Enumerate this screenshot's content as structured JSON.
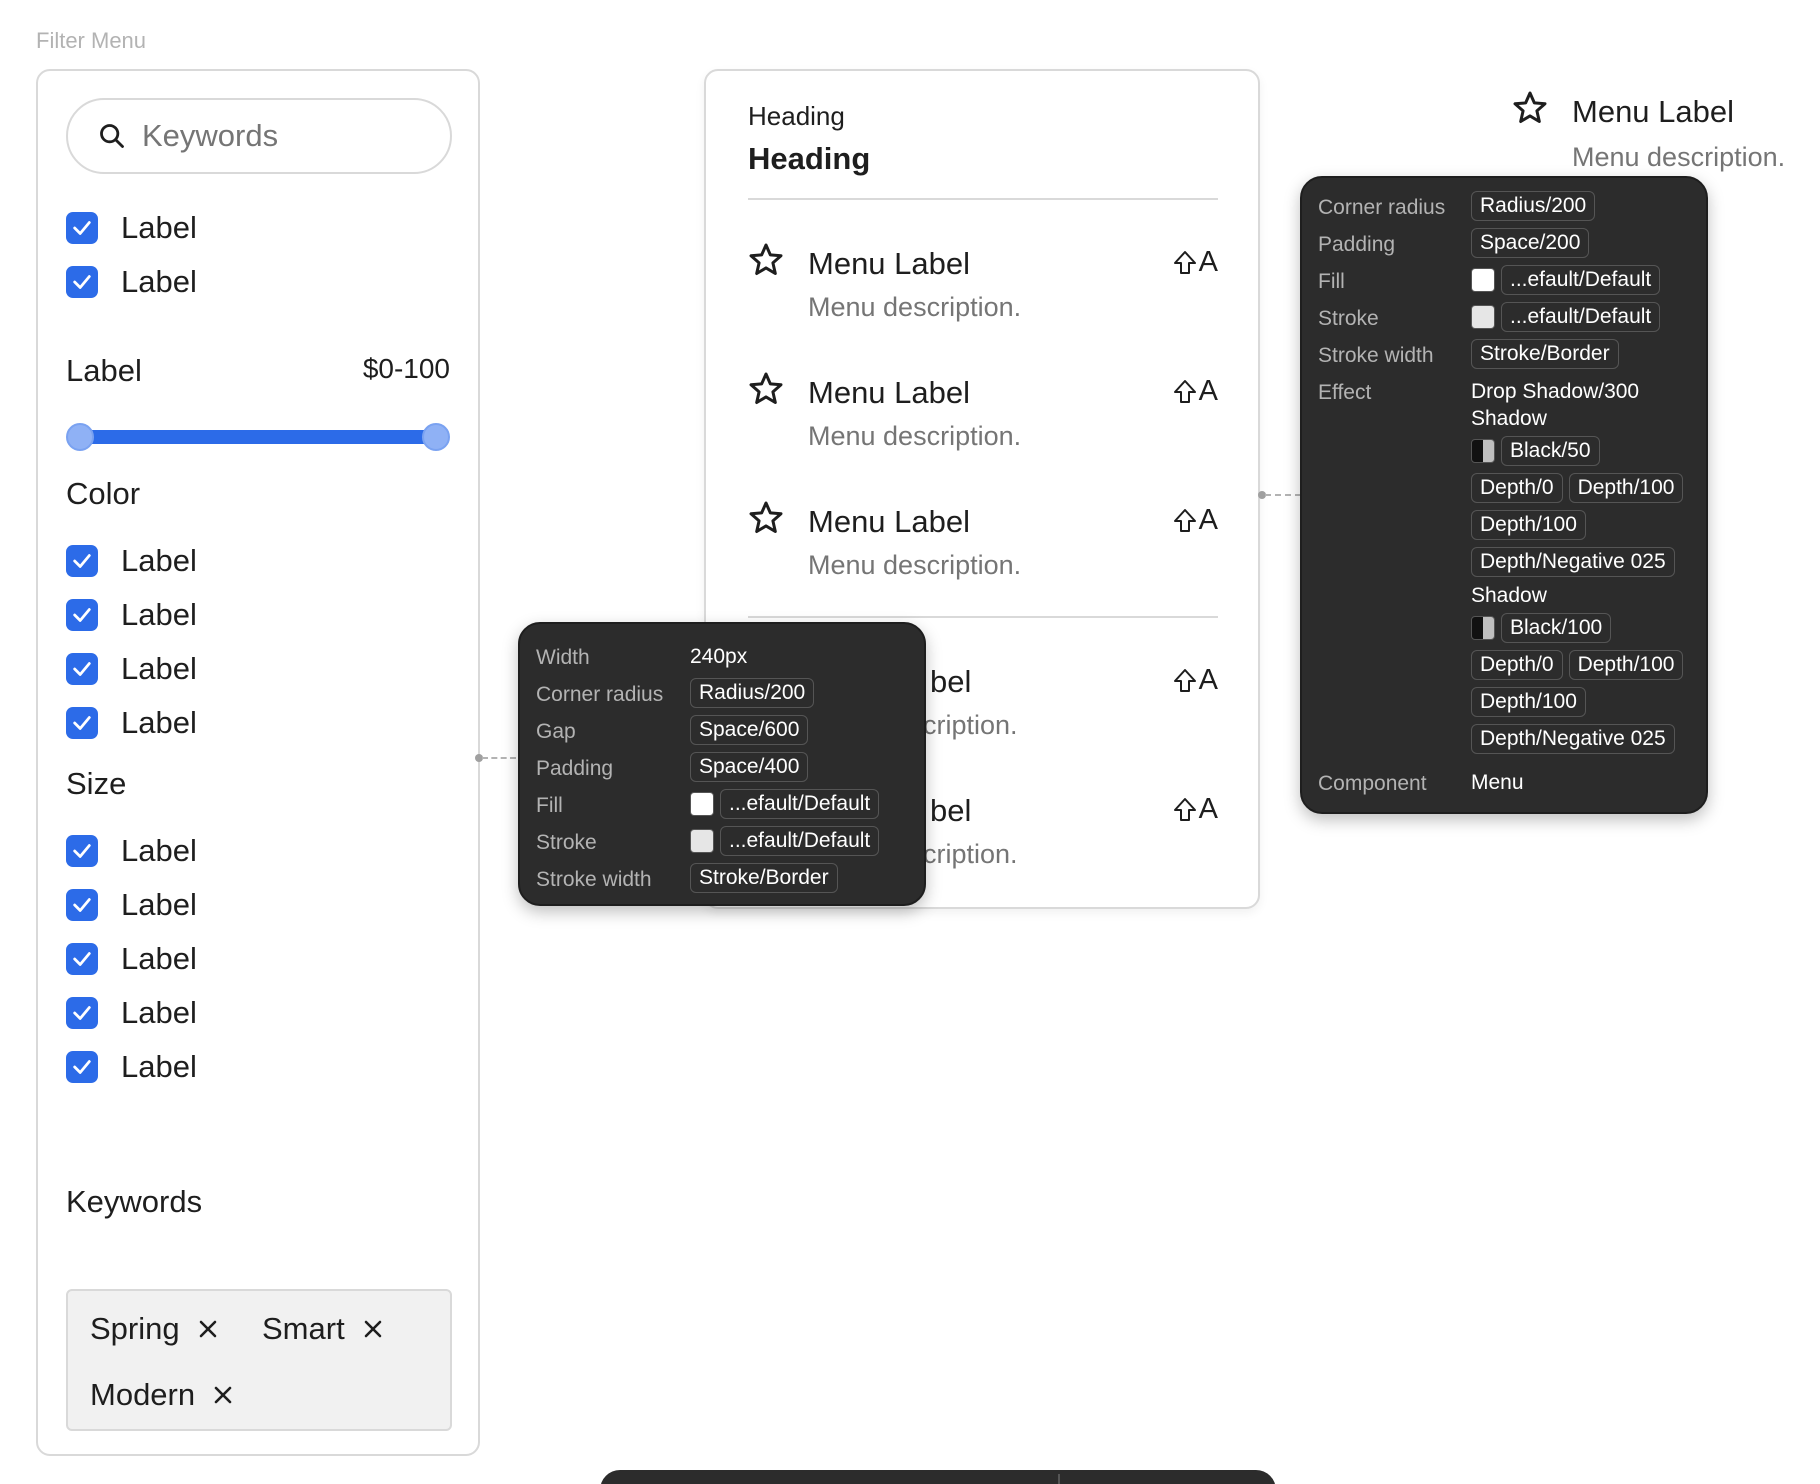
{
  "frame_title": "Filter Menu",
  "filter": {
    "search_placeholder": "Keywords",
    "top_checkboxes": [
      "Label",
      "Label"
    ],
    "price": {
      "label": "Label",
      "value": "$0-100",
      "range_min_fraction": 0.0,
      "range_max_fraction": 1.0
    },
    "color": {
      "title": "Color",
      "items": [
        "Label",
        "Label",
        "Label",
        "Label"
      ]
    },
    "size": {
      "title": "Size",
      "items": [
        "Label",
        "Label",
        "Label",
        "Label",
        "Label"
      ]
    },
    "keywords": {
      "title": "Keywords",
      "tags": [
        "Spring",
        "Smart",
        "Modern"
      ]
    }
  },
  "menu": {
    "heading_small": "Heading",
    "heading_big": "Heading",
    "items": [
      {
        "label": "Menu Label",
        "description": "Menu description.",
        "shortcut_key": "A"
      },
      {
        "label": "Menu Label",
        "description": "Menu description.",
        "shortcut_key": "A"
      },
      {
        "label": "Menu Label",
        "description": "Menu description.",
        "shortcut_key": "A"
      },
      {
        "label": "Menu Label",
        "description": "Menu description.",
        "shortcut_key": "A"
      },
      {
        "label": "Menu Label",
        "description": "Menu description.",
        "shortcut_key": "A"
      }
    ],
    "visible_label_fragment": "bel",
    "visible_desc_fragment": "cription."
  },
  "solo_item": {
    "label": "Menu Label",
    "description": "Menu description."
  },
  "inspector_left": {
    "rows": [
      {
        "key": "Width",
        "plain": "240px"
      },
      {
        "key": "Corner radius",
        "pill": "Radius/200"
      },
      {
        "key": "Gap",
        "pill": "Space/600"
      },
      {
        "key": "Padding",
        "pill": "Space/400"
      },
      {
        "key": "Fill",
        "pill": "...efault/Default"
      },
      {
        "key": "Stroke",
        "pill": "...efault/Default"
      },
      {
        "key": "Stroke width",
        "pill": "Stroke/Border"
      }
    ]
  },
  "inspector_right": {
    "corner_radius_key": "Corner radius",
    "corner_radius": "Radius/200",
    "padding_key": "Padding",
    "padding": "Space/200",
    "fill_key": "Fill",
    "fill": "...efault/Default",
    "stroke_key": "Stroke",
    "stroke": "...efault/Default",
    "stroke_width_key": "Stroke width",
    "stroke_width": "Stroke/Border",
    "effect_key": "Effect",
    "effect": "Drop Shadow/300",
    "shadow1": {
      "title": "Shadow",
      "color": "Black/50",
      "x": "Depth/0",
      "y": "Depth/100",
      "blur": "Depth/100",
      "spread": "Depth/Negative 025"
    },
    "shadow2": {
      "title": "Shadow",
      "color": "Black/100",
      "x": "Depth/0",
      "y": "Depth/100",
      "blur": "Depth/100",
      "spread": "Depth/Negative 025"
    },
    "component_key": "Component",
    "component": "Menu"
  },
  "colors": {
    "accent": "#2c6be8",
    "slider_thumb": "#8fb1f5",
    "inspector_bg": "#2c2c2c",
    "border": "#d9d9d9",
    "muted_text": "#757575"
  },
  "icons": {
    "search": "search-icon",
    "checkbox": "check-icon",
    "star": "star-icon",
    "shortcut": "shift-arrow-icon",
    "remove": "close-icon"
  }
}
